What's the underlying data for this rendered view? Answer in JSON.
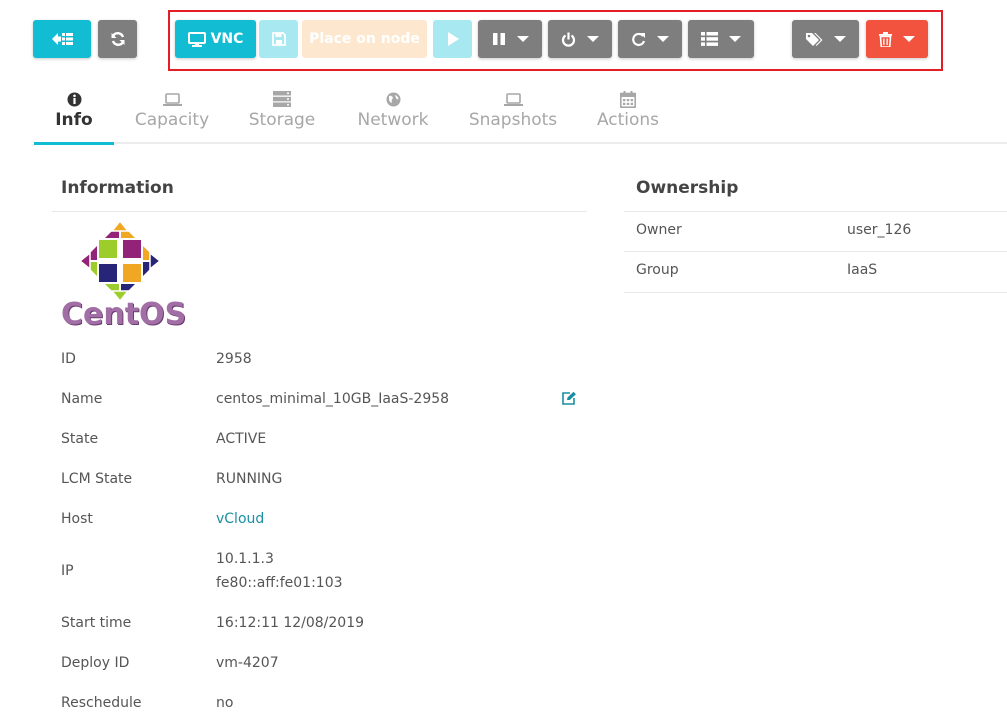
{
  "toolbar": {
    "back_icon": "arrow-left-list-icon",
    "refresh_icon": "refresh-icon",
    "vnc_label": "VNC",
    "save_icon": "floppy-icon",
    "place_on_node_label": "Place on node",
    "play_icon": "play-icon",
    "pause_icon": "pause-icon",
    "power_icon": "power-icon",
    "reboot_icon": "reboot-icon",
    "list_icon": "list-icon",
    "tags_icon": "tags-icon",
    "trash_icon": "trash-icon"
  },
  "tabs": [
    {
      "label": "Info",
      "icon": "info-circle-icon",
      "active": true
    },
    {
      "label": "Capacity",
      "icon": "laptop-icon",
      "active": false
    },
    {
      "label": "Storage",
      "icon": "server-icon",
      "active": false
    },
    {
      "label": "Network",
      "icon": "globe-icon",
      "active": false
    },
    {
      "label": "Snapshots",
      "icon": "laptop-icon",
      "active": false
    },
    {
      "label": "Actions",
      "icon": "calendar-icon",
      "active": false
    }
  ],
  "information": {
    "title": "Information",
    "logo_text": "CentOS",
    "rows": [
      {
        "label": "ID",
        "value": "2958"
      },
      {
        "label": "Name",
        "value": "centos_minimal_10GB_IaaS-2958"
      },
      {
        "label": "State",
        "value": "ACTIVE"
      },
      {
        "label": "LCM State",
        "value": "RUNNING"
      },
      {
        "label": "Host",
        "value": "vCloud"
      },
      {
        "label": "IP",
        "value": "10.1.1.3",
        "value2": "fe80::aff:fe01:103"
      },
      {
        "label": "Start time",
        "value": "16:12:11 12/08/2019"
      },
      {
        "label": "Deploy ID",
        "value": "vm-4207"
      },
      {
        "label": "Reschedule",
        "value": "no"
      }
    ]
  },
  "ownership": {
    "title": "Ownership",
    "rows": [
      {
        "label": "Owner",
        "value": "user_126"
      },
      {
        "label": "Group",
        "value": "IaaS"
      }
    ]
  },
  "colors": {
    "teal": "#12bcd3",
    "grey": "#7e7e7e",
    "red": "#f1533e",
    "link": "#1a8fa3",
    "highlight": "#e41e26"
  }
}
